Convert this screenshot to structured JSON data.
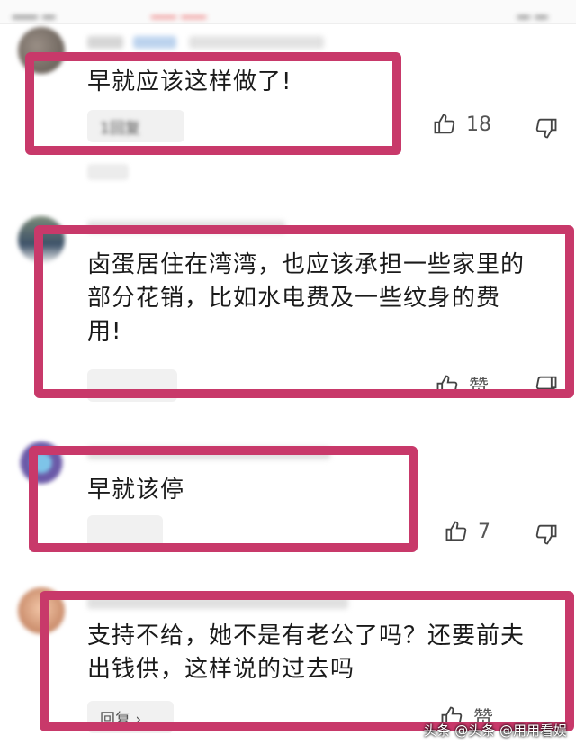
{
  "comments": [
    {
      "text": "早就应该这样做了!",
      "reply_label": "1回复",
      "like_count": "18"
    },
    {
      "text_lines": [
        "卤蛋居住在湾湾，也应该承担一些家里的",
        "部分花销，比如水电费及一些纹身的费",
        "用!"
      ],
      "reply_label": "",
      "like_label": "赞"
    },
    {
      "text": "早就该停",
      "reply_label": "",
      "like_count": "7"
    },
    {
      "text_lines": [
        "支持不给，她不是有老公了吗？还要前夫",
        "出钱供，这样说的过去吗"
      ],
      "reply_label": "回复 ›",
      "like_label": "赞"
    }
  ],
  "watermark": "头条 @头条 @用用看娱",
  "colors": {
    "highlight": "#c8396a",
    "pill": "#f1f1f1"
  }
}
